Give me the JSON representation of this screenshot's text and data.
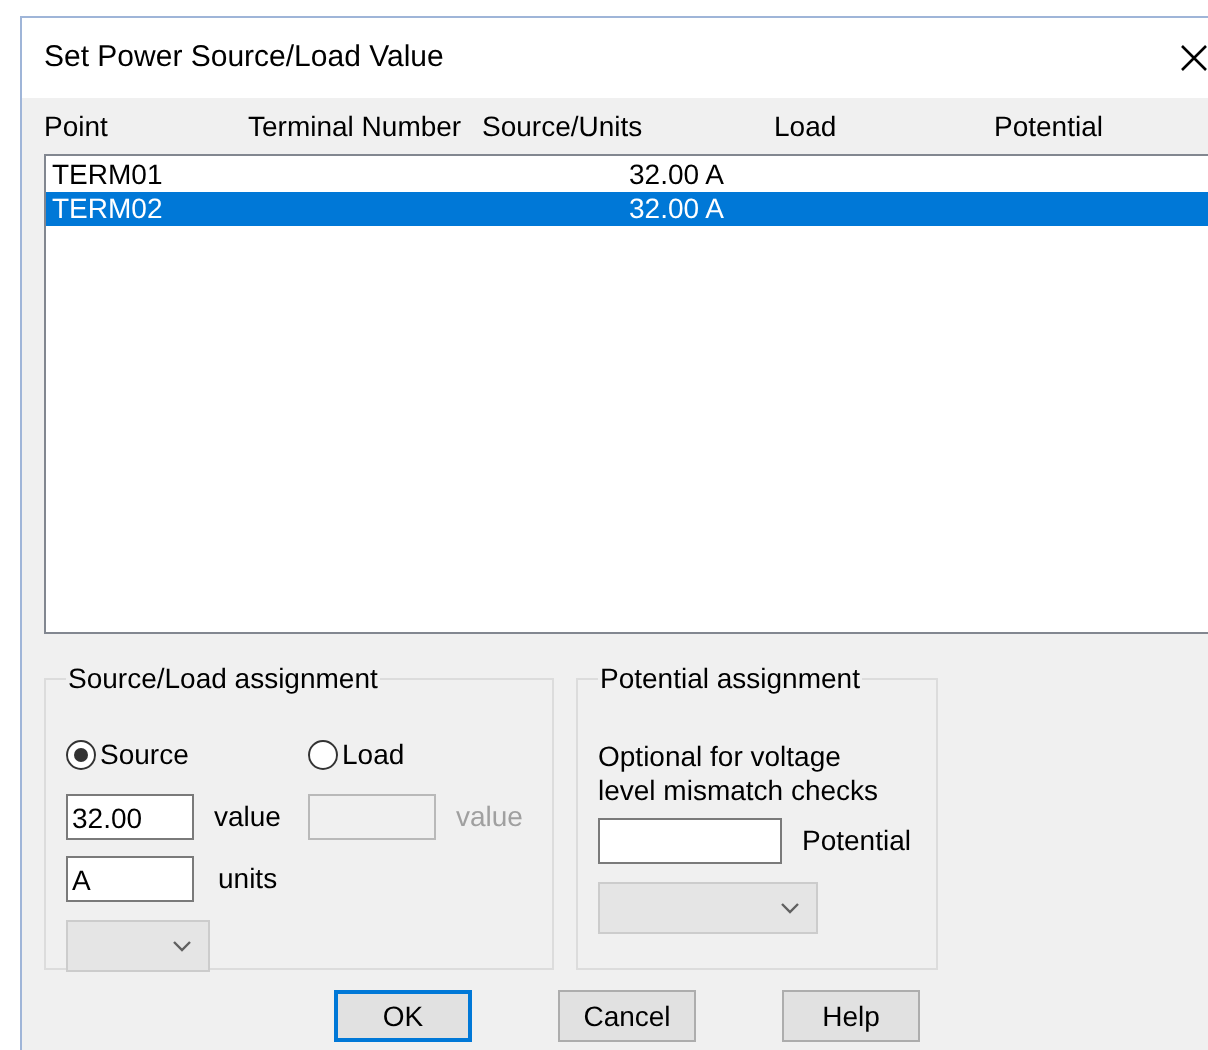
{
  "window": {
    "title": "Set Power Source/Load Value"
  },
  "list": {
    "columns": [
      "Point",
      "Terminal Number",
      "Source/Units",
      "Load",
      "Potential"
    ],
    "rows": [
      {
        "point": "TERM01",
        "source_units": "32.00 A",
        "selected": false
      },
      {
        "point": "TERM02",
        "source_units": "32.00 A",
        "selected": true
      }
    ]
  },
  "source_load": {
    "title": "Source/Load assignment",
    "options": [
      {
        "label": "Source",
        "selected": true
      },
      {
        "label": "Load",
        "selected": false
      }
    ],
    "source_value": {
      "value": "32.00",
      "label": "value",
      "disabled": false
    },
    "load_value": {
      "label": "value",
      "disabled": true
    },
    "units": {
      "value": "A",
      "label": "units"
    },
    "unit_dropdown": {
      "disabled": true
    }
  },
  "potential": {
    "title": "Potential assignment",
    "note": "Optional for voltage level mismatch checks",
    "field": {
      "label": "Potential"
    },
    "dropdown": {
      "disabled": true
    }
  },
  "buttons": [
    {
      "label": "OK",
      "default": true
    },
    {
      "label": "Cancel",
      "default": false
    },
    {
      "label": "Help",
      "default": false
    }
  ]
}
